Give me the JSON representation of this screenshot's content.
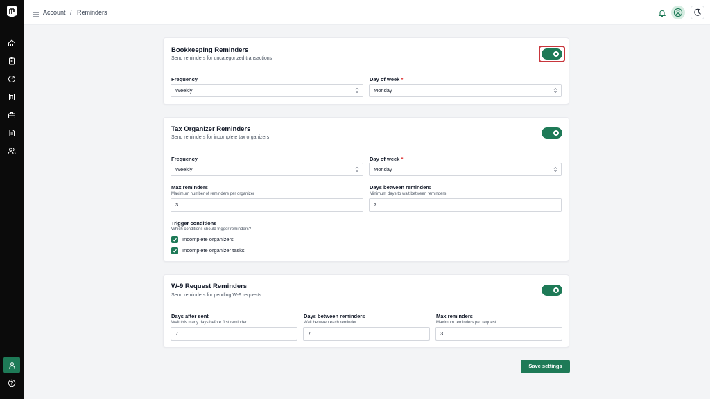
{
  "breadcrumb": {
    "parent": "Account",
    "separator": "/",
    "current": "Reminders"
  },
  "colors": {
    "brand": "#1e7a57",
    "sidebar": "#0b0b0b",
    "required": "#dc2626",
    "focus": "#c8363c"
  },
  "bookkeeping": {
    "title": "Bookkeeping Reminders",
    "subtitle": "Send reminders for uncategorized transactions",
    "enabled": true,
    "frequency": {
      "label": "Frequency",
      "value": "Weekly"
    },
    "day_of_week": {
      "label": "Day of week",
      "required": "*",
      "value": "Monday"
    }
  },
  "tax_organizer": {
    "title": "Tax Organizer Reminders",
    "subtitle": "Send reminders for incomplete tax organizers",
    "enabled": true,
    "frequency": {
      "label": "Frequency",
      "value": "Weekly"
    },
    "day_of_week": {
      "label": "Day of week",
      "required": "*",
      "value": "Monday"
    },
    "max_reminders": {
      "label": "Max reminders",
      "hint": "Maximum number of reminders per organizer",
      "value": "3"
    },
    "days_between": {
      "label": "Days between reminders",
      "hint": "Minimum days to wait between reminders",
      "value": "7"
    },
    "trigger": {
      "label": "Trigger conditions",
      "hint": "Which conditions should trigger reminders?",
      "options": [
        {
          "label": "Incomplete organizers",
          "checked": true
        },
        {
          "label": "Incomplete organizer tasks",
          "checked": true
        }
      ]
    }
  },
  "w9": {
    "title": "W-9 Request Reminders",
    "subtitle": "Send reminders for pending W-9 requests",
    "enabled": true,
    "days_after_sent": {
      "label": "Days after sent",
      "hint": "Wait this many days before first reminder",
      "value": "7"
    },
    "days_between": {
      "label": "Days between reminders",
      "hint": "Wait between each reminder",
      "value": "7"
    },
    "max_reminders": {
      "label": "Max reminders",
      "hint": "Maximum reminders per request",
      "value": "3"
    }
  },
  "save_label": "Save settings",
  "icons": {
    "sidebar": [
      "home-icon",
      "clipboard-icon",
      "gauge-icon",
      "calculator-icon",
      "briefcase-icon",
      "document-icon",
      "users-icon"
    ],
    "sidebar_bottom": [
      "user-icon",
      "help-icon"
    ],
    "topbar": [
      "menu-icon",
      "bell-icon",
      "user-circle-icon",
      "moon-icon"
    ]
  }
}
